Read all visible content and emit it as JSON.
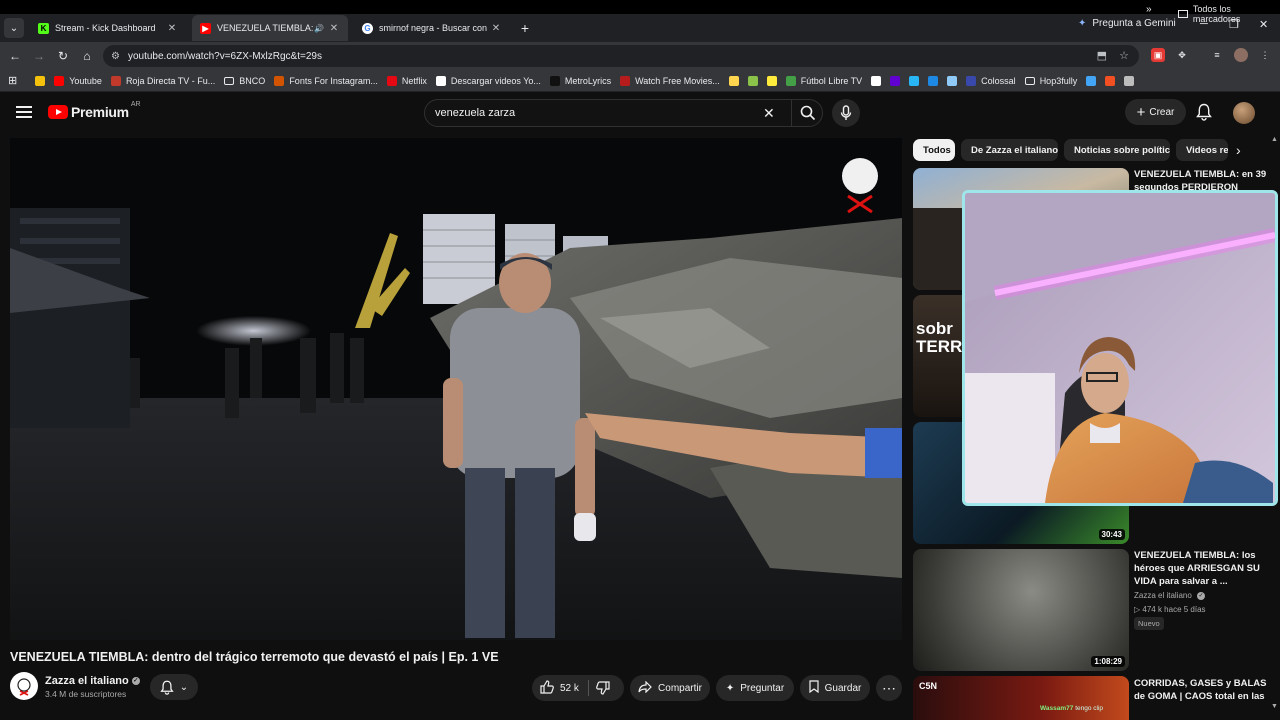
{
  "browser": {
    "tabs": [
      {
        "title": "Stream - Kick Dashboard",
        "favicon": "kick-icon",
        "active": false
      },
      {
        "title": "VENEZUELA TIEMBLA: dentro",
        "favicon": "youtube-icon",
        "active": true,
        "audio": true
      },
      {
        "title": "smirnof negra - Buscar con Goo",
        "favicon": "google-icon",
        "active": false
      }
    ],
    "gemini_label": "Pregunta a Gemini",
    "url": "youtube.com/watch?v=6ZX-MxlzRgc&t=29s",
    "bookmarks": [
      {
        "label": "",
        "icon": "emoji-icon",
        "color": "#f4c20d"
      },
      {
        "label": "Youtube",
        "icon": "youtube-icon",
        "color": "#ff0000"
      },
      {
        "label": "Roja Directa TV - Fu...",
        "icon": "roja-icon",
        "color": "#c0392b"
      },
      {
        "label": "BNCO",
        "icon": "folder-icon",
        "color": "#e8eaed"
      },
      {
        "label": "Fonts For Instagram...",
        "icon": "fonts-icon",
        "color": "#d35400"
      },
      {
        "label": "Netflix",
        "icon": "netflix-icon",
        "color": "#e50914"
      },
      {
        "label": "Descargar videos Yo...",
        "icon": "download-icon",
        "color": "#ffffff"
      },
      {
        "label": "MetroLyrics",
        "icon": "metrolyrics-icon",
        "color": "#111111"
      },
      {
        "label": "Watch Free Movies...",
        "icon": "movies-icon",
        "color": "#b71c1c"
      },
      {
        "label": "",
        "icon": "bookmark-icon-a",
        "color": "#ffd54f"
      },
      {
        "label": "",
        "icon": "bookmark-icon-b",
        "color": "#8bc34a"
      },
      {
        "label": "",
        "icon": "bookmark-icon-c",
        "color": "#ffeb3b"
      },
      {
        "label": "Fútbol Libre TV",
        "icon": "futbol-icon",
        "color": "#43a047"
      },
      {
        "label": "",
        "icon": "bookmark-icon-d",
        "color": "#ffffff"
      },
      {
        "label": "",
        "icon": "yahoo-icon",
        "color": "#6001d2"
      },
      {
        "label": "",
        "icon": "bookmark-icon-e",
        "color": "#29b6f6"
      },
      {
        "label": "",
        "icon": "bookmark-icon-f",
        "color": "#1e88e5"
      },
      {
        "label": "",
        "icon": "bookmark-icon-g",
        "color": "#90caf9"
      },
      {
        "label": "Colossal",
        "icon": "colossal-icon",
        "color": "#3949ab"
      },
      {
        "label": "Hop3fully",
        "icon": "folder-icon",
        "color": "#e8eaed"
      },
      {
        "label": "",
        "icon": "bookmark-icon-h",
        "color": "#42a5f5"
      },
      {
        "label": "",
        "icon": "microsoft-icon",
        "color": "#f25022"
      },
      {
        "label": "",
        "icon": "globe-icon",
        "color": "#bdbdbd"
      }
    ],
    "all_bookmarks_label": "Todos los marcadores"
  },
  "youtube": {
    "logo_text": "Premium",
    "region": "AR",
    "search_value": "venezuela zarza",
    "create_label": "Crear",
    "video": {
      "title": "VENEZUELA TIEMBLA: dentro del trágico terremoto que devastó el país | Ep. 1 VE",
      "channel": "Zazza el italiano",
      "subscribers": "3.4 M de suscriptores",
      "likes": "52 k",
      "share_label": "Compartir",
      "ask_label": "Preguntar",
      "save_label": "Guardar"
    },
    "chips": [
      {
        "label": "Todos",
        "active": true
      },
      {
        "label": "De Zazza el italiano",
        "active": false
      },
      {
        "label": "Noticias sobre política",
        "active": false
      },
      {
        "label": "Videos re",
        "active": false
      }
    ],
    "related": [
      {
        "title": "VENEZUELA TIEMBLA: en 39 segundos PERDIERON",
        "channel": "",
        "meta": "",
        "duration": "",
        "badge": ""
      },
      {
        "title": "",
        "channel": "",
        "meta": "",
        "duration": "",
        "badge": "",
        "overlay_text": "sobr TERREM"
      },
      {
        "title": "",
        "channel": "",
        "meta": "",
        "duration": "30:43",
        "badge": ""
      },
      {
        "title": "VENEZUELA TIEMBLA: los héroes que ARRIESGAN SU VIDA para salvar a ...",
        "channel": "Zazza el italiano",
        "meta": "474 k  hace 5 días",
        "duration": "1:08:29",
        "badge": "Nuevo"
      },
      {
        "title": "CORRIDAS, GASES y BALAS de GOMA | CAOS total en las",
        "channel": "",
        "meta": "",
        "duration": "",
        "badge": "",
        "overlay_text": "C5N"
      }
    ]
  },
  "chat_overlay": {
    "user": "Wassam77",
    "message": "tengo clip"
  }
}
